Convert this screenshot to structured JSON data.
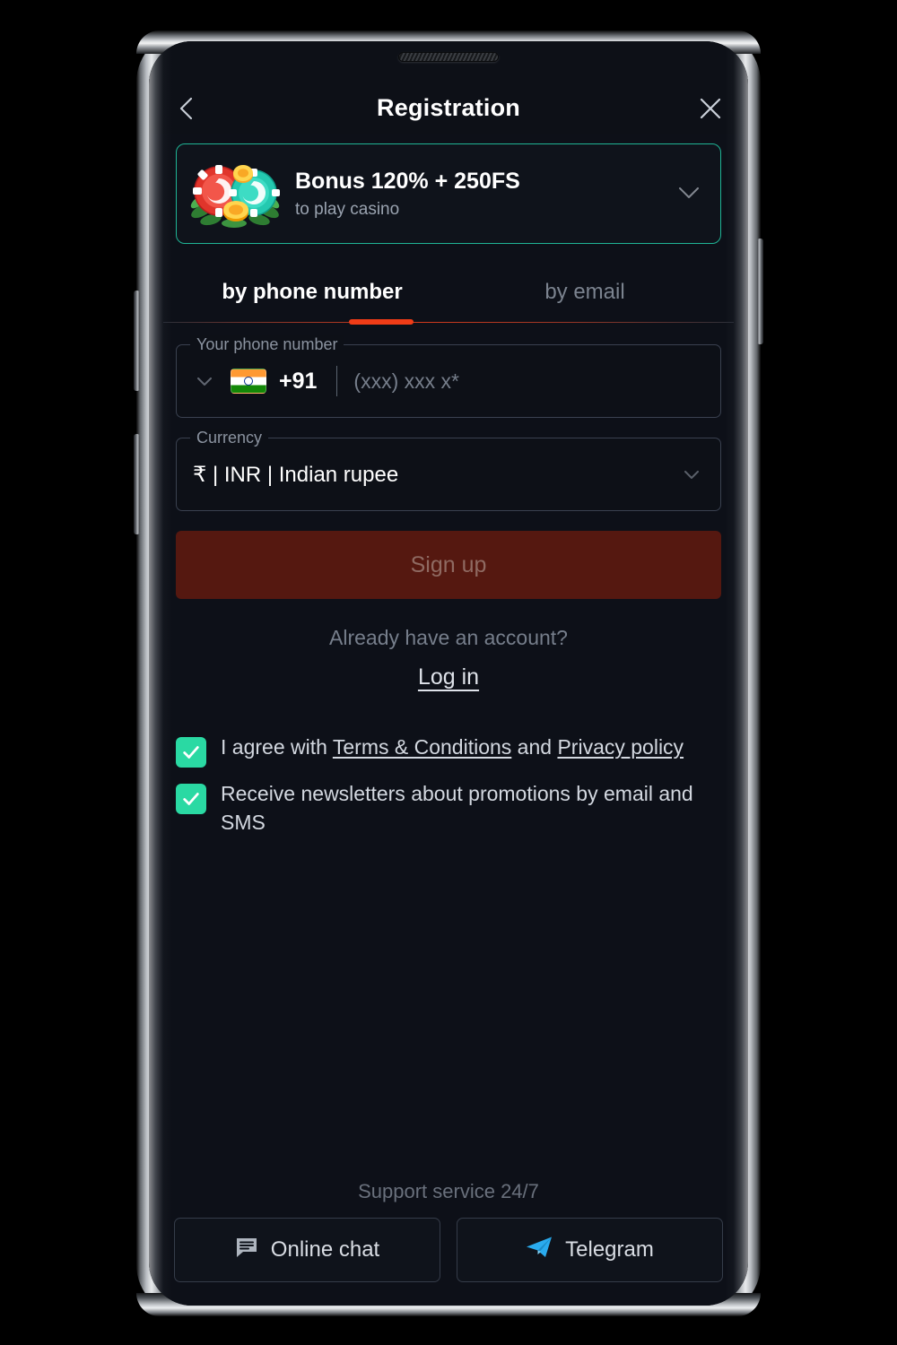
{
  "header": {
    "title": "Registration",
    "back_icon": "chevron-left-icon",
    "close_icon": "close-icon"
  },
  "bonus": {
    "title": "Bonus 120% + 250FS",
    "subtitle": "to play casino",
    "art_icon": "casino-chips-icon",
    "expand_icon": "chevron-down-icon",
    "border_color": "#1fb495"
  },
  "tabs": {
    "active_index": 0,
    "items": [
      {
        "label": "by phone number"
      },
      {
        "label": "by email"
      }
    ],
    "underline_color": "#f03c17"
  },
  "phone_field": {
    "legend": "Your phone number",
    "country_flag": "india-flag-icon",
    "dial_code": "+91",
    "value": "",
    "placeholder": "(xxx) xxx x*",
    "dropdown_icon": "chevron-down-icon"
  },
  "currency_field": {
    "legend": "Currency",
    "value": "₹ | INR | Indian rupee",
    "dropdown_icon": "chevron-down-icon"
  },
  "signup": {
    "label": "Sign up",
    "color": "#551810",
    "text_color": "#8f6a62"
  },
  "login": {
    "prompt": "Already have an account?",
    "link_label": "Log in"
  },
  "agreements": [
    {
      "checked": true,
      "prefix": "I agree with ",
      "link1": "Terms & Conditions",
      "middle": " and ",
      "link2": "Privacy policy",
      "suffix": ""
    },
    {
      "checked": true,
      "text": "Receive newsletters about promotions by email and SMS"
    }
  ],
  "checkbox_color": "#2ad9a3",
  "support": {
    "label": "Support service 24/7",
    "buttons": [
      {
        "label": "Online chat",
        "icon": "chat-bubble-icon"
      },
      {
        "label": "Telegram",
        "icon": "telegram-icon",
        "icon_color": "#2aabee"
      }
    ]
  }
}
